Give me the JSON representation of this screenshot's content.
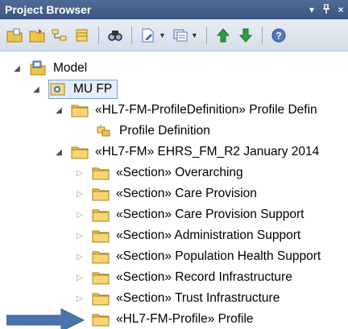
{
  "window": {
    "title": "Project Browser"
  },
  "titlebar_controls": [
    {
      "name": "dropdown-icon",
      "glyph": "▾"
    },
    {
      "name": "pin-icon",
      "glyph": "Ǫ"
    },
    {
      "name": "close-icon",
      "glyph": "×"
    }
  ],
  "toolbar": {
    "buttons": [
      "new-model-icon",
      "new-package-icon",
      "new-diagram-icon",
      "new-element-icon",
      "find-icon",
      "document-icon",
      "project-icon",
      "move-up-icon",
      "move-down-icon",
      "help-icon"
    ]
  },
  "tree": {
    "model": {
      "label": "Model",
      "icon": "model-root-icon"
    },
    "mufp": {
      "label": "MU FP",
      "icon": "view-icon",
      "selected": true
    },
    "profdef_pkg": {
      "label": "«HL7-FM-ProfileDefinition» Profile Defin",
      "icon": "folder-icon"
    },
    "profdef_elem": {
      "label": "Profile Definition",
      "icon": "class-element-icon"
    },
    "ehrs_pkg": {
      "label": "«HL7-FM» EHRS_FM_R2 January 2014",
      "icon": "folder-icon"
    },
    "sections": [
      {
        "label": "«Section» Overarching"
      },
      {
        "label": "«Section» Care Provision"
      },
      {
        "label": "«Section» Care Provision Support"
      },
      {
        "label": "«Section» Administration Support"
      },
      {
        "label": "«Section» Population Health Support"
      },
      {
        "label": "«Section» Record Infrastructure"
      },
      {
        "label": "«Section» Trust Infrastructure"
      }
    ],
    "profile_pkg": {
      "label": "«HL7-FM-Profile» Profile",
      "icon": "folder-icon"
    }
  },
  "colors": {
    "titlebar": "#3b5682",
    "folder": "#f0c24a",
    "arrow": "#4a74ad"
  }
}
